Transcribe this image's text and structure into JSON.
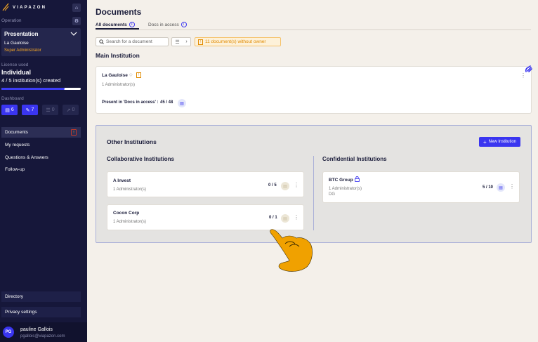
{
  "sidebar": {
    "logo_text": "VIAPAZON",
    "section_label": "Operation",
    "org": {
      "title": "Presentation",
      "name": "La Gauloise",
      "role": "Super Administrator"
    },
    "license": {
      "label": "License used",
      "type": "Individual",
      "count": "4 / 5 institution(s) created",
      "usage_fraction": 0.8
    },
    "dashboard": {
      "label": "Dashboard",
      "buttons": [
        {
          "icon": "document-icon",
          "value": "6"
        },
        {
          "icon": "pencil-icon",
          "value": "7"
        },
        {
          "icon": "list-icon",
          "value": "0"
        },
        {
          "icon": "chart-icon",
          "value": "0"
        }
      ]
    },
    "nav": [
      {
        "label": "Documents",
        "badge": "!"
      },
      {
        "label": "My requests"
      },
      {
        "label": "Questions & Answers"
      },
      {
        "label": "Follow-up"
      }
    ],
    "bottom": {
      "directory": "Directory",
      "privacy": "Privacy settings"
    },
    "user": {
      "initials": "PG",
      "name": "pauline Gallois",
      "email": "pgallois@viapazon.com"
    }
  },
  "main": {
    "title": "Documents",
    "tabs": [
      {
        "label": "All documents"
      },
      {
        "label": "Docs in access"
      }
    ],
    "search_placeholder": "Search for a document",
    "warning": "11 document(s) without owner",
    "main_institution": {
      "heading": "Main Institution",
      "name": "La Gauloise",
      "admins": "1 Administrator(s)",
      "access_label": "Present in 'Docs in access' :",
      "access_count": "45 / 48"
    },
    "others": {
      "heading": "Other Institutions",
      "new_button": "New Institution",
      "collab_heading": "Collaborative Institutions",
      "conf_heading": "Confidential Institutions",
      "collab": [
        {
          "name": "A Invest",
          "admins": "1 Administrator(s)",
          "count": "0 / 5"
        },
        {
          "name": "Cocon Corp",
          "admins": "1 Administrator(s)",
          "count": "0 / 1"
        }
      ],
      "conf": [
        {
          "name": "BTC Group",
          "admins": "1 Administrator(s)",
          "extra": "DG",
          "count": "5 / 10"
        }
      ]
    }
  }
}
